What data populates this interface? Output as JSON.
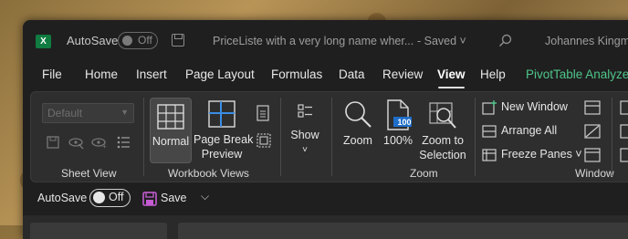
{
  "titlebar": {
    "logo": "X",
    "autosave_label": "AutoSave",
    "autosave_state": "Off",
    "document_title": "PriceListe with a very long name wher...",
    "document_status": "-  Saved  ˅",
    "user_name": "Johannes Kingma"
  },
  "tabs": [
    {
      "label": "File"
    },
    {
      "label": "Home"
    },
    {
      "label": "Insert"
    },
    {
      "label": "Page Layout"
    },
    {
      "label": "Formulas"
    },
    {
      "label": "Data"
    },
    {
      "label": "Review"
    },
    {
      "label": "View"
    },
    {
      "label": "Help"
    },
    {
      "label": "PivotTable Analyze"
    }
  ],
  "ribbon": {
    "sheet_view": {
      "dropdown_value": "Default",
      "group_label": "Sheet View"
    },
    "workbook_views": {
      "normal": "Normal",
      "page_break_line1": "Page Break",
      "page_break_line2": "Preview",
      "group_label": "Workbook Views"
    },
    "show": {
      "label": "Show",
      "chevron": "˅"
    },
    "zoom": {
      "zoom": "Zoom",
      "hundred": "100%",
      "hundred_badge": "100",
      "zoom_sel_line1": "Zoom to",
      "zoom_sel_line2": "Selection",
      "group_label": "Zoom"
    },
    "window": {
      "new_window": "New Window",
      "arrange_all": "Arrange All",
      "freeze_panes": "Freeze Panes ˅",
      "group_label": "Window"
    }
  },
  "quick_access": {
    "autosave_label": "AutoSave",
    "autosave_state": "Off",
    "save_label": "Save",
    "more": "⌵"
  },
  "colors": {
    "accent_green": "#4fc58a",
    "excel_green": "#107c41",
    "save_icon_purple": "#c35bd1",
    "zoom_badge_blue": "#1e6ec8"
  }
}
